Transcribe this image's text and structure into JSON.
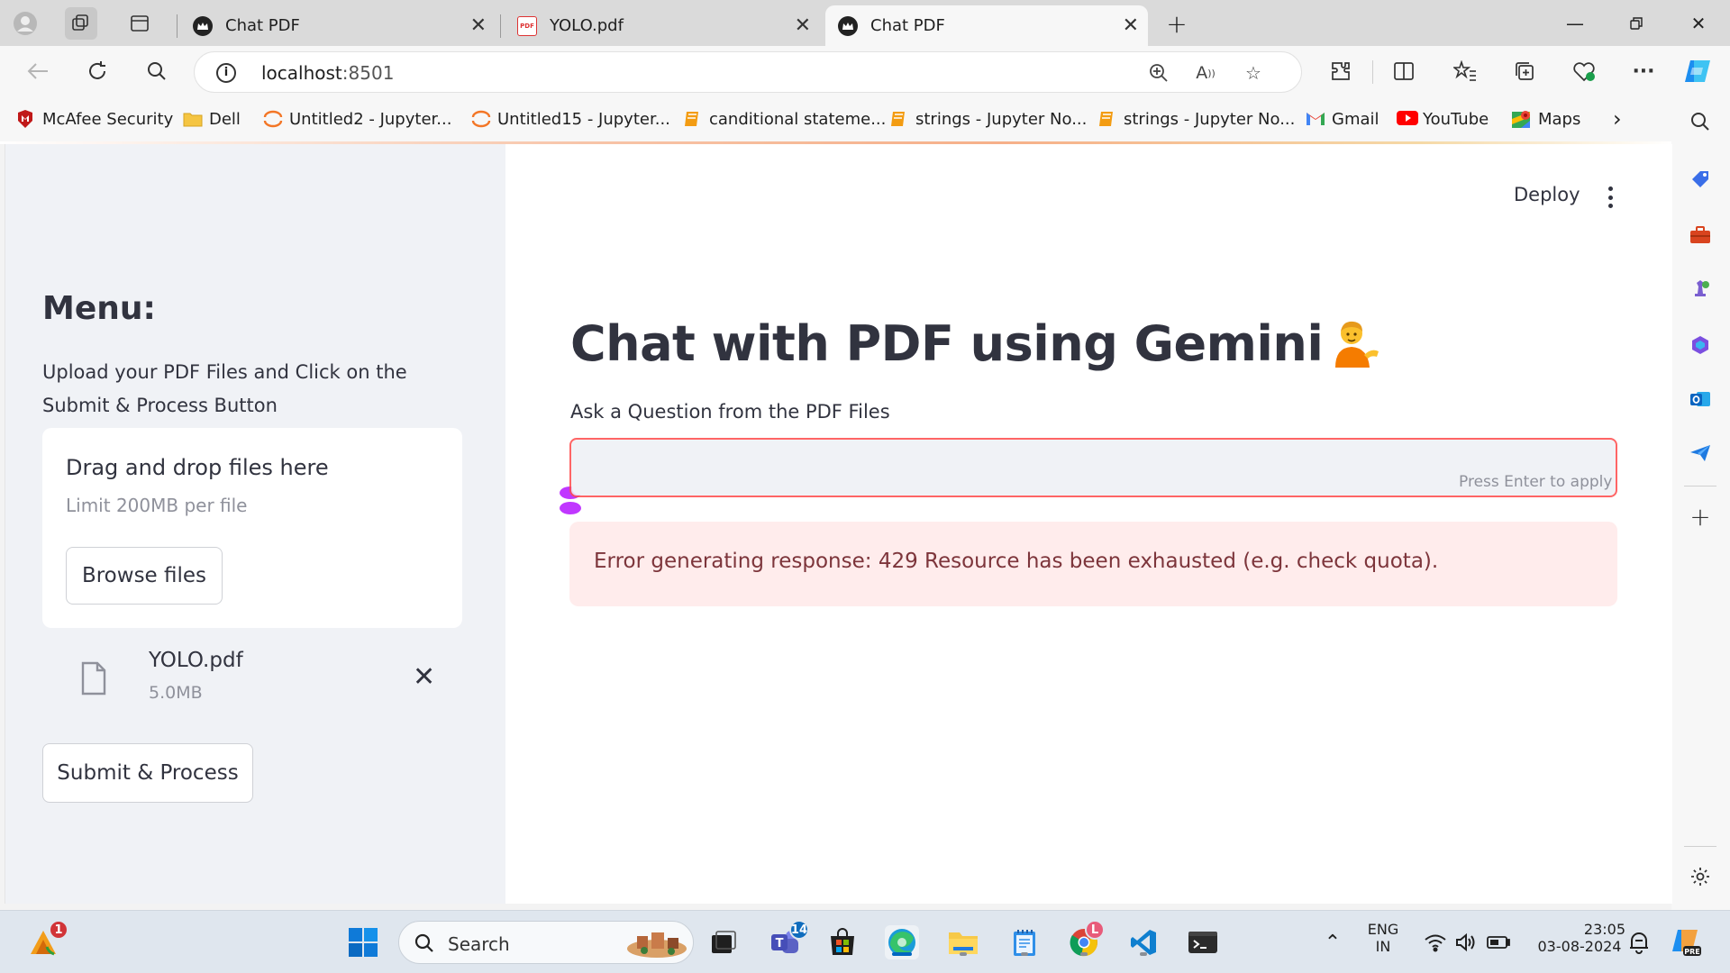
{
  "browser": {
    "tabs": [
      {
        "title": "Chat PDF",
        "active": false
      },
      {
        "title": "YOLO.pdf",
        "active": false
      },
      {
        "title": "Chat PDF",
        "active": true
      }
    ],
    "address": {
      "host": "localhost",
      "port": ":8501"
    },
    "bookmarks": [
      {
        "label": "McAfee Security",
        "icon": "mcafee-icon"
      },
      {
        "label": "Dell",
        "icon": "folder-icon"
      },
      {
        "label": "Untitled2 - Jupyter...",
        "icon": "jupyter-icon"
      },
      {
        "label": "Untitled15 - Jupyter...",
        "icon": "jupyter-icon"
      },
      {
        "label": "canditional stateme...",
        "icon": "notebook-icon"
      },
      {
        "label": "strings - Jupyter No...",
        "icon": "notebook-icon"
      },
      {
        "label": "strings - Jupyter No...",
        "icon": "notebook-icon"
      },
      {
        "label": "Gmail",
        "icon": "gmail-icon"
      },
      {
        "label": "YouTube",
        "icon": "youtube-icon"
      },
      {
        "label": "Maps",
        "icon": "maps-icon"
      }
    ]
  },
  "sidebar": {
    "title": "Menu:",
    "description": "Upload your PDF Files and Click on the Submit & Process Button",
    "uploader": {
      "title": "Drag and drop files here",
      "limit": "Limit 200MB per file",
      "browse_label": "Browse files"
    },
    "file": {
      "name": "YOLO.pdf",
      "size": "5.0MB"
    },
    "submit_label": "Submit & Process"
  },
  "main": {
    "deploy_label": "Deploy",
    "title": "Chat with PDF using Gemini",
    "title_emoji": "person-tipping-hand-emoji",
    "question_label": "Ask a Question from the PDF Files",
    "question_value": "",
    "input_hint": "Press Enter to apply",
    "error_text": "Error generating response: 429 Resource has been exhausted (e.g. check quota)."
  },
  "taskbar": {
    "search_label": "Search",
    "teams_badge": "14",
    "widgets_badge": "1",
    "chrome_badge": "L",
    "language": "ENG",
    "region": "IN",
    "time": "23:05",
    "date": "03-08-2024"
  },
  "colors": {
    "streamlit_text": "#31333f",
    "sidebar_bg": "#f0f2f6",
    "input_border": "#ff4b4b",
    "error_bg": "#ffecec",
    "error_text": "#7d353b"
  }
}
